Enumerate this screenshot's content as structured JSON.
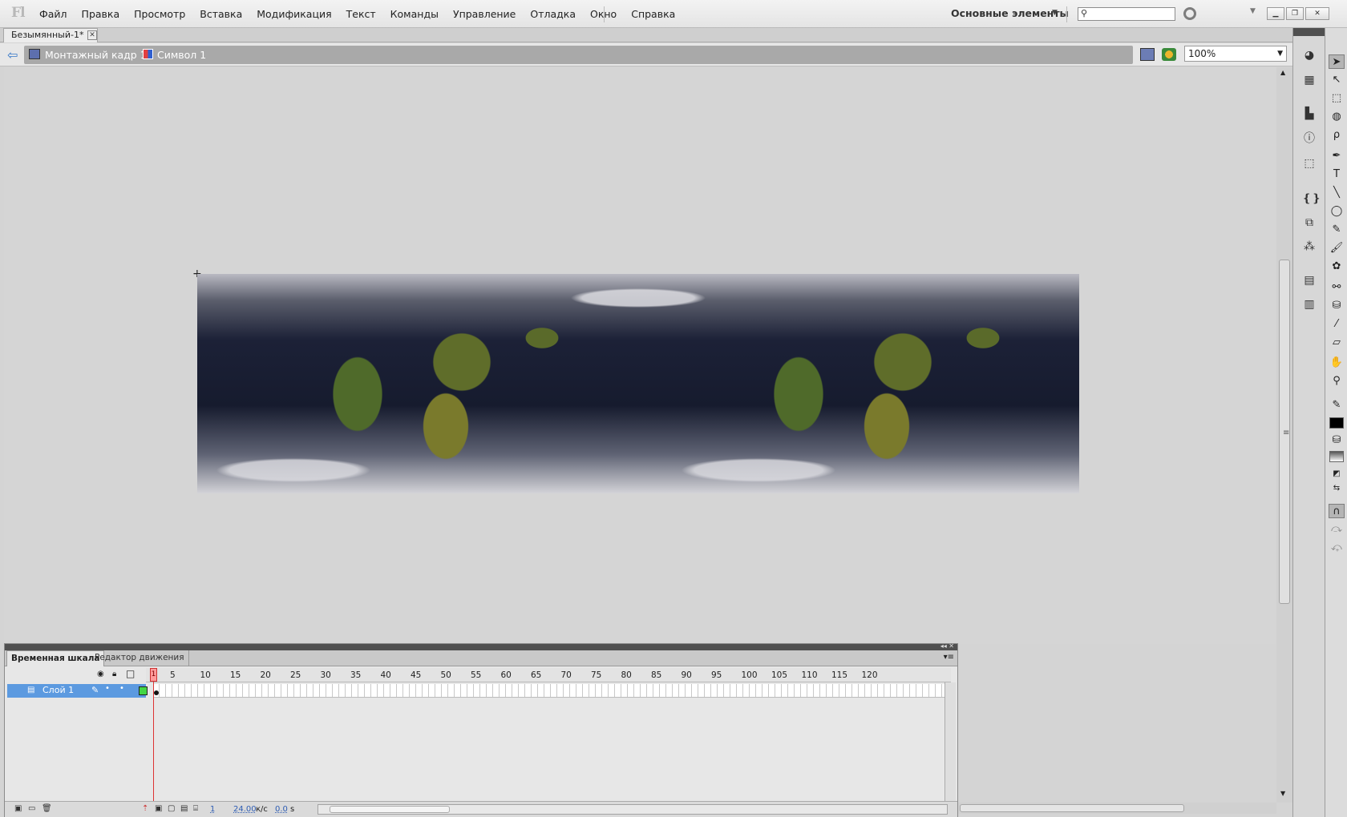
{
  "app": {
    "logo": "Fl",
    "menu": [
      "Файл",
      "Правка",
      "Просмотр",
      "Вставка",
      "Модификация",
      "Текст",
      "Команды",
      "Управление",
      "Отладка",
      "Окно",
      "Справка"
    ],
    "workspace": "Основные элементы",
    "search_placeholder": ""
  },
  "document": {
    "tab_title": "Безымянный-1*"
  },
  "editbar": {
    "scene": "Монтажный кадр 1",
    "symbol": "Символ 1",
    "zoom": "100%"
  },
  "stage": {
    "image_name": "world-satellite-cloud-map"
  },
  "timeline": {
    "tab_timeline": "Временная шкала",
    "tab_motion_editor": "Редактор движения",
    "ticks": [
      "1",
      "5",
      "10",
      "15",
      "20",
      "25",
      "30",
      "35",
      "40",
      "45",
      "50",
      "55",
      "60",
      "65",
      "70",
      "75",
      "80",
      "85",
      "90",
      "95",
      "100",
      "105",
      "110",
      "115",
      "120"
    ],
    "layer_name": "Слой 1",
    "current_frame": "1",
    "frame_rate": "24.00",
    "frame_rate_unit": "к/с",
    "elapsed": "0.0",
    "elapsed_unit": "s"
  },
  "tools": [
    "selection-icon",
    "subselection-icon",
    "free-transform-icon",
    "3d-rotation-icon",
    "lasso-icon",
    "pen-icon",
    "text-icon",
    "line-icon",
    "oval-icon",
    "pencil-icon",
    "brush-icon",
    "deco-icon",
    "bone-icon",
    "paint-bucket-icon",
    "eyedropper-icon",
    "eraser-icon",
    "hand-icon",
    "zoom-icon"
  ],
  "colors": {
    "stroke": "#000000",
    "layer_highlight": "#5c9ae0",
    "layer_outline": "#43d645"
  }
}
